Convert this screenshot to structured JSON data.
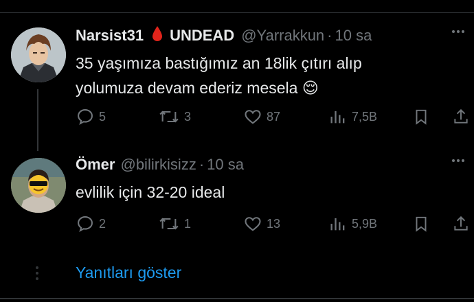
{
  "tweets": [
    {
      "name": "Narsist31",
      "tag": "UNDEAD",
      "handle": "@Yarrakkun",
      "separator": "·",
      "time": "10 sa",
      "text": "35 yaşımıza bastığımız an 18lik çıtırı alıp yolumuza devam ederiz mesela 😌",
      "stats": {
        "replies": "5",
        "reposts": "3",
        "likes": "87",
        "views": "7,5B"
      },
      "emblem_icon": "blood-drop-icon",
      "emblem_color": "#e0241b"
    },
    {
      "name": "Ömer",
      "handle": "@bilirkisizz",
      "separator": "·",
      "time": "10 sa",
      "text": "evlilik için 32-20 ideal",
      "stats": {
        "replies": "2",
        "reposts": "1",
        "likes": "13",
        "views": "5,9B"
      }
    }
  ],
  "show_replies_label": "Yanıtları göster",
  "colors": {
    "background": "#000000",
    "text": "#e7e9ea",
    "muted": "#71767b",
    "link": "#1d9bf0"
  },
  "icons": [
    "reply-icon",
    "repost-icon",
    "like-icon",
    "views-icon",
    "bookmark-icon",
    "share-icon",
    "more-icon"
  ]
}
